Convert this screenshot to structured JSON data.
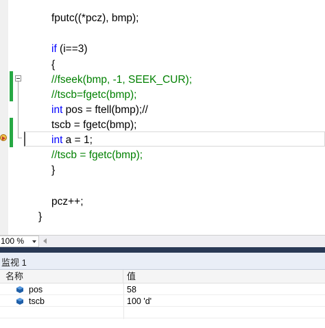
{
  "editor": {
    "lines": [
      {
        "id": "l1",
        "parts": [
          {
            "t": "fputc((*pcz), bmp);",
            "c": ""
          }
        ]
      },
      {
        "id": "l2",
        "parts": [
          {
            "t": "if",
            "c": "kw"
          },
          {
            "t": " (i==3)",
            "c": ""
          }
        ]
      },
      {
        "id": "l3",
        "parts": [
          {
            "t": "{",
            "c": ""
          }
        ]
      },
      {
        "id": "l4",
        "parts": [
          {
            "t": "//fseek(bmp, -1, SEEK_CUR);",
            "c": "cm"
          }
        ]
      },
      {
        "id": "l5",
        "parts": [
          {
            "t": "//tscb=fgetc(bmp);",
            "c": "cm"
          }
        ]
      },
      {
        "id": "l6",
        "parts": [
          {
            "t": "int",
            "c": "kw"
          },
          {
            "t": " pos = ftell(bmp);//",
            "c": ""
          }
        ]
      },
      {
        "id": "l7",
        "parts": [
          {
            "t": "tscb = fgetc(bmp);",
            "c": ""
          }
        ]
      },
      {
        "id": "l8",
        "parts": [
          {
            "t": "int",
            "c": "kw"
          },
          {
            "t": " a = 1;",
            "c": ""
          }
        ]
      },
      {
        "id": "l9",
        "parts": [
          {
            "t": "//tscb = fgetc(bmp);",
            "c": "cm"
          }
        ]
      },
      {
        "id": "l10",
        "parts": [
          {
            "t": "}",
            "c": ""
          }
        ]
      },
      {
        "id": "l11",
        "parts": [
          {
            "t": "pcz++;",
            "c": ""
          }
        ]
      },
      {
        "id": "l12",
        "parts": [
          {
            "t": "}",
            "c": ""
          }
        ]
      }
    ]
  },
  "zoom": {
    "value": "100 %"
  },
  "watch": {
    "title": "监视 1",
    "columns": {
      "name": "名称",
      "value": "值"
    },
    "rows": [
      {
        "name": "pos",
        "value": "58"
      },
      {
        "name": "tscb",
        "value": "100 'd'"
      }
    ]
  },
  "colors": {
    "keyword": "#0000ff",
    "comment": "#008000",
    "change_bar": "#27a844",
    "watch_header": "#293955"
  }
}
